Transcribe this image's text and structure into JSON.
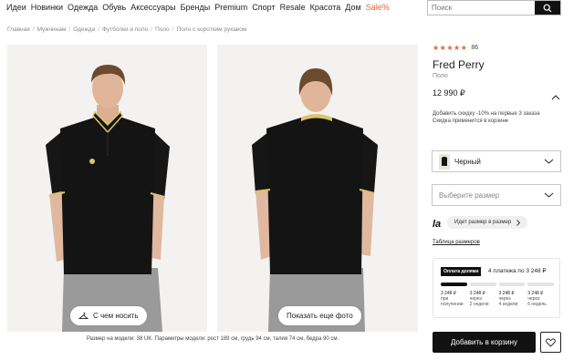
{
  "topnav": {
    "items": [
      "Идеи",
      "Новинки",
      "Одежда",
      "Обувь",
      "Аксессуары",
      "Бренды",
      "Premium",
      "Спорт",
      "Resale",
      "Красота",
      "Дом"
    ],
    "sale": "Sale%"
  },
  "search": {
    "placeholder": "Поиск"
  },
  "breadcrumb": [
    "Главная",
    "Мужчинам",
    "Одежда",
    "Футболки и поло",
    "Поло",
    "Поло с коротким рукавом"
  ],
  "photos": {
    "try_on_label": "С чем носить",
    "more_photos_label": "Показать еще фото",
    "model_caption": "Размер на модели: 38 UK. Параметры модели: рост 189 см, грудь 94 см, талия 74 см, бедра 90 см."
  },
  "product": {
    "rating_stars": 5,
    "rating_count": "86",
    "brand": "Fred Perry",
    "category": "Поло",
    "price": "12 990 ₽",
    "promo_line1": "Добавить скидку -10% на первые 3 заказа",
    "promo_line2": "Скидка применится в корзине"
  },
  "selectors": {
    "color_value": "Черный",
    "size_placeholder": "Выберите размер"
  },
  "size_help": {
    "logo": "la",
    "pill_label": "Идет размер в размер",
    "table_link": "Таблица размеров"
  },
  "installments": {
    "badge": "Оплата долями",
    "title": "4 платежа по 3 248 ₽",
    "active_count": 1,
    "payments": [
      {
        "amount": "3 248 ₽",
        "line1": "при",
        "line2": "получении"
      },
      {
        "amount": "3 248 ₽",
        "line1": "через",
        "line2": "2 недели"
      },
      {
        "amount": "3 248 ₽",
        "line1": "через",
        "line2": "4 недели"
      },
      {
        "amount": "3 248 ₽",
        "line1": "через",
        "line2": "6 недель"
      }
    ]
  },
  "actions": {
    "add_to_cart": "Добавить в корзину"
  },
  "colors": {
    "accent": "#e8623b",
    "shirt": "#141414",
    "tipping": "#d9c46a"
  }
}
